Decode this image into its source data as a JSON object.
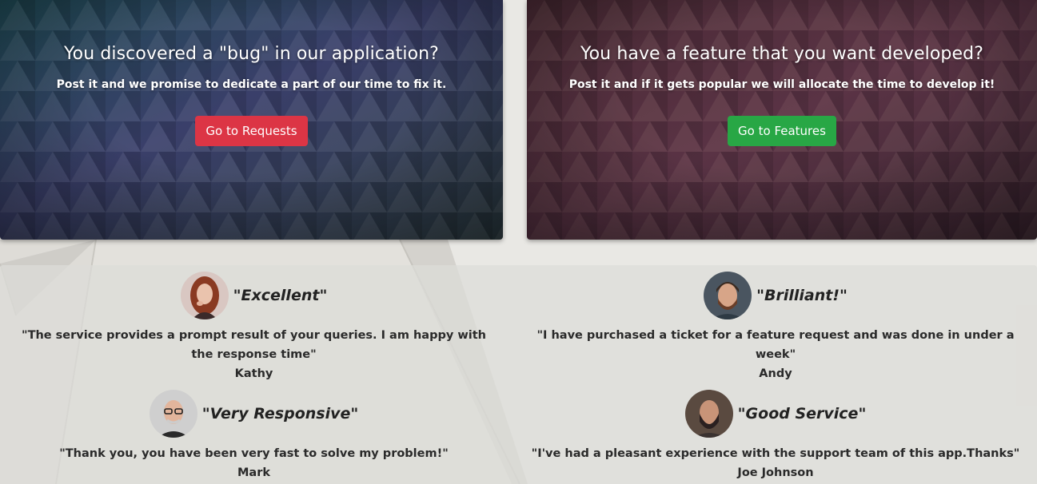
{
  "cards": [
    {
      "title": "You discovered a \"bug\" in our application?",
      "subtitle": "Post it and we promise to dedicate a part of our time to fix it.",
      "button_label": "Go to Requests",
      "button_color": "#dc3545"
    },
    {
      "title": "You have a feature that you want developed?",
      "subtitle": "Post it and if it gets popular we will allocate the time to develop it!",
      "button_label": "Go to Features",
      "button_color": "#28a745"
    }
  ],
  "testimonials": [
    {
      "title": "\"Excellent\"",
      "quote": "\"The service provides a prompt result of your queries. I am happy with the response time\"",
      "name": "Kathy",
      "avatar_icon": "avatar-woman-red-hair"
    },
    {
      "title": "\"Brilliant!\"",
      "quote": "\"I have purchased a ticket for a feature request and was done in under a week\"",
      "name": "Andy",
      "avatar_icon": "avatar-man-beard"
    },
    {
      "title": "\"Very Responsive\"",
      "quote": "\"Thank you, you have been very fast to solve my problem!\"",
      "name": "Mark",
      "avatar_icon": "avatar-man-glasses-bald"
    },
    {
      "title": "\"Good Service\"",
      "quote": "\"I've had a pleasant experience with the support team of this app.Thanks\"",
      "name": "Joe Johnson",
      "avatar_icon": "avatar-man-dark-beard"
    }
  ]
}
